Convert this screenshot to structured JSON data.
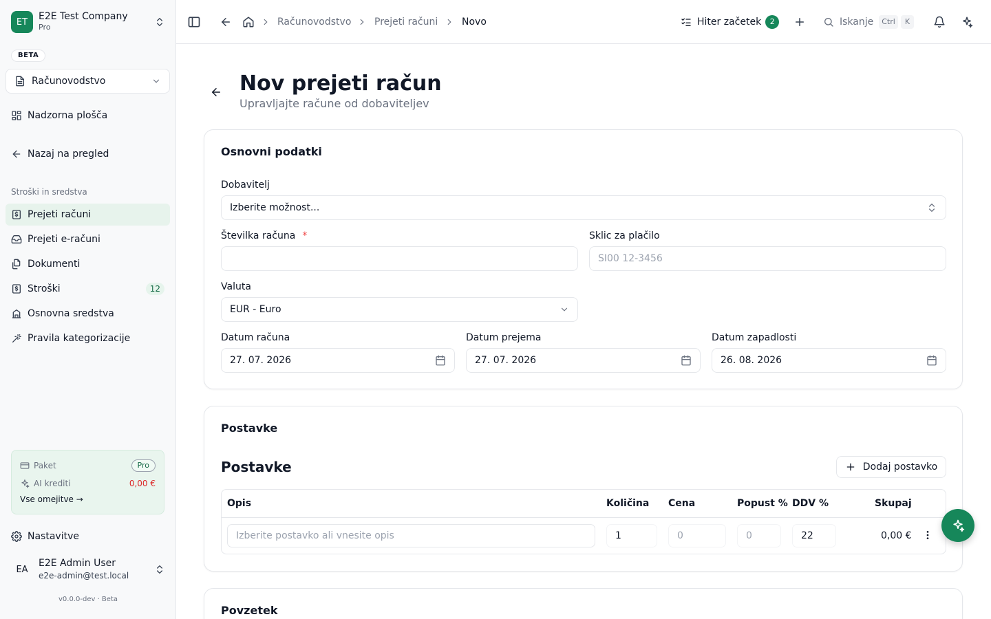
{
  "company": {
    "initials": "ET",
    "name": "E2E Test Company",
    "plan": "Pro"
  },
  "beta_label": "BETA",
  "module": {
    "label": "Računovodstvo"
  },
  "nav": {
    "dashboard": "Nadzorna plošča",
    "back": "Nazaj na pregled",
    "section": "Stroški in sredstva",
    "items": [
      {
        "label": "Prejeti računi",
        "icon": "receipt-icon"
      },
      {
        "label": "Prejeti e-računi",
        "icon": "inbox-icon"
      },
      {
        "label": "Dokumenti",
        "icon": "files-icon"
      },
      {
        "label": "Stroški",
        "icon": "receipt-icon",
        "count": "12"
      },
      {
        "label": "Osnovna sredstva",
        "icon": "building-icon"
      },
      {
        "label": "Pravila kategorizacije",
        "icon": "wand-icon"
      }
    ],
    "settings": "Nastavitve"
  },
  "plan_card": {
    "package_label": "Paket",
    "package_value": "Pro",
    "ai_label": "AI krediti",
    "ai_value": "0,00 €",
    "limits_link": "Vse omejitve →"
  },
  "user": {
    "initials": "EA",
    "name": "E2E Admin User",
    "email": "e2e-admin@test.local"
  },
  "version": "v0.0.0-dev · Beta",
  "header": {
    "breadcrumbs": [
      "Računovodstvo",
      "Prejeti računi",
      "Novo"
    ],
    "quick_start": "Hiter začetek",
    "quick_start_count": "2",
    "search": "Iskanje",
    "kbd_ctrl": "Ctrl",
    "kbd_k": "K"
  },
  "page": {
    "title": "Nov prejeti račun",
    "subtitle": "Upravljajte račune od dobaviteljev"
  },
  "basic": {
    "title": "Osnovni podatki",
    "supplier_label": "Dobavitelj",
    "supplier_placeholder": "Izberite možnost...",
    "invoice_number_label": "Številka računa",
    "required_mark": "*",
    "invoice_number_value": "",
    "reference_label": "Sklic za plačilo",
    "reference_placeholder": "SI00 12-3456",
    "currency_label": "Valuta",
    "currency_value": "EUR - Euro",
    "invoice_date_label": "Datum računa",
    "invoice_date_value": "27. 07. 2026",
    "received_date_label": "Datum prejema",
    "received_date_value": "27. 07. 2026",
    "due_date_label": "Datum zapadlosti",
    "due_date_value": "26. 08. 2026"
  },
  "items": {
    "card_title": "Postavke",
    "heading": "Postavke",
    "add_button": "Dodaj postavko",
    "columns": [
      "Opis",
      "Količina",
      "Cena",
      "Popust %",
      "DDV %",
      "Skupaj"
    ],
    "row": {
      "description_placeholder": "Izberite postavko ali vnesite opis",
      "quantity": "1",
      "price_placeholder": "0",
      "discount_placeholder": "0",
      "vat": "22",
      "total": "0,00 €"
    }
  },
  "summary": {
    "title": "Povzetek"
  },
  "colors": {
    "accent": "#16875a",
    "active_nav_bg": "#e7f3ec",
    "danger": "#dc2626"
  }
}
